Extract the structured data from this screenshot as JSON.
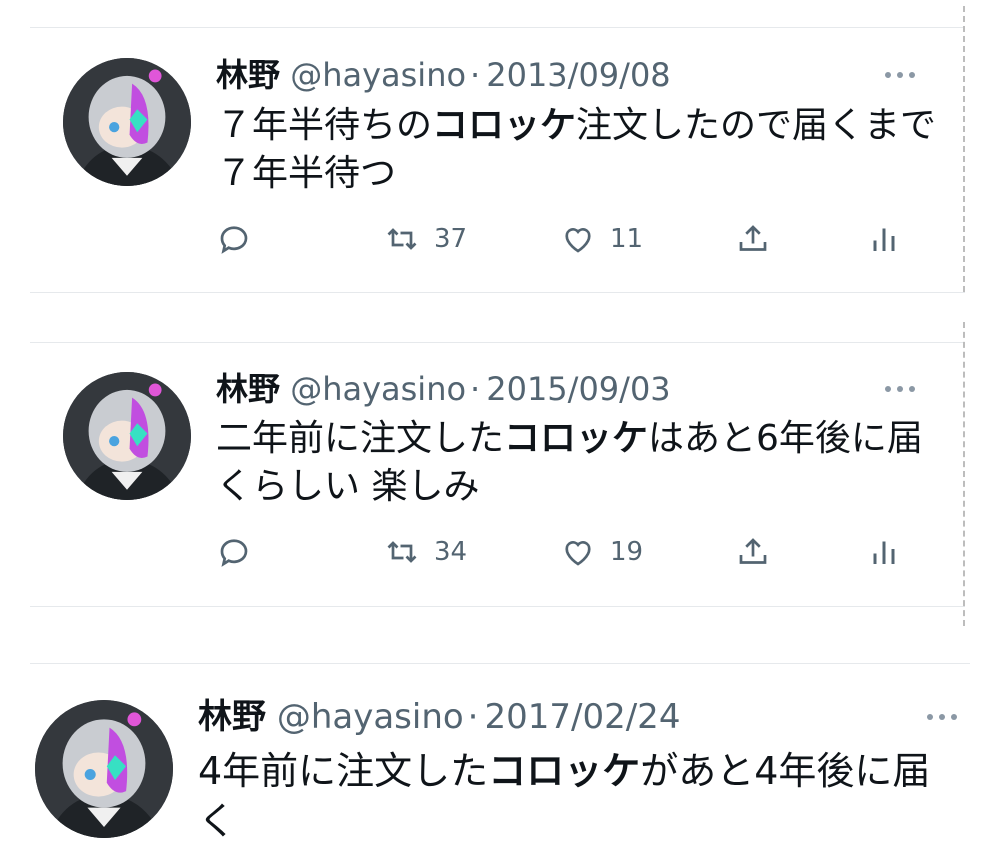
{
  "colors": {
    "text": "#0f1419",
    "muted": "#536471",
    "icon": "#536471",
    "separator": "#e6e9ec"
  },
  "tweets": [
    {
      "name": "林野",
      "handle": "@hayasino",
      "dot": "·",
      "date": "2013/09/08",
      "lines": [
        {
          "pre": "７年半待ちの",
          "kw": "コロッケ",
          "post": "注文したので届くまで"
        },
        {
          "pre": "７年半待つ",
          "kw": "",
          "post": ""
        }
      ],
      "retweets": "37",
      "likes": "11",
      "icons": {
        "reply": "reply-icon",
        "retweet": "retweet-icon",
        "like": "heart-icon",
        "share": "share-icon",
        "analytics": "analytics-icon",
        "more": "more-icon"
      }
    },
    {
      "name": "林野",
      "handle": "@hayasino",
      "dot": "·",
      "date": "2015/09/03",
      "lines": [
        {
          "pre": "二年前に注文した",
          "kw": "コロッケ",
          "post": "はあと6年後に届"
        },
        {
          "pre": "くらしい 楽しみ",
          "kw": "",
          "post": ""
        }
      ],
      "retweets": "34",
      "likes": "19",
      "icons": {
        "reply": "reply-icon",
        "retweet": "retweet-icon",
        "like": "heart-icon",
        "share": "share-icon",
        "analytics": "analytics-icon",
        "more": "more-icon"
      }
    },
    {
      "name": "林野",
      "handle": "@hayasino",
      "dot": "·",
      "date": "2017/02/24",
      "lines": [
        {
          "pre": "4年前に注文した",
          "kw": "コロッケ",
          "post": "があと4年後に届"
        },
        {
          "pre": "く",
          "kw": "",
          "post": ""
        }
      ],
      "icons": {
        "more": "more-icon"
      }
    }
  ]
}
